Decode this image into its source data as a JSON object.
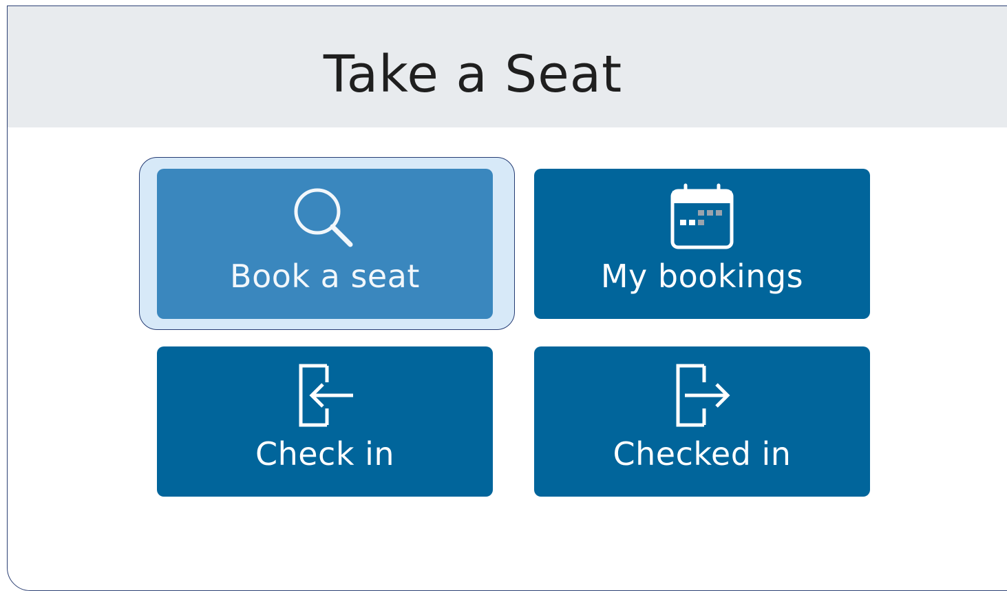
{
  "header": {
    "title": "Take a Seat"
  },
  "tiles": [
    {
      "label": "Book a seat",
      "icon": "search-icon",
      "state": "hover"
    },
    {
      "label": "My bookings",
      "icon": "calendar-icon",
      "state": "default"
    },
    {
      "label": "Check in",
      "icon": "check-in-icon",
      "state": "default"
    },
    {
      "label": "Checked in",
      "icon": "check-out-icon",
      "state": "default"
    }
  ],
  "colors": {
    "tile": "#01659b",
    "tile_active": "#3a87be",
    "header_bg": "#e8ebee",
    "focus_ring_bg": "#d7e9f8",
    "frame_border": "#2b3f73"
  }
}
